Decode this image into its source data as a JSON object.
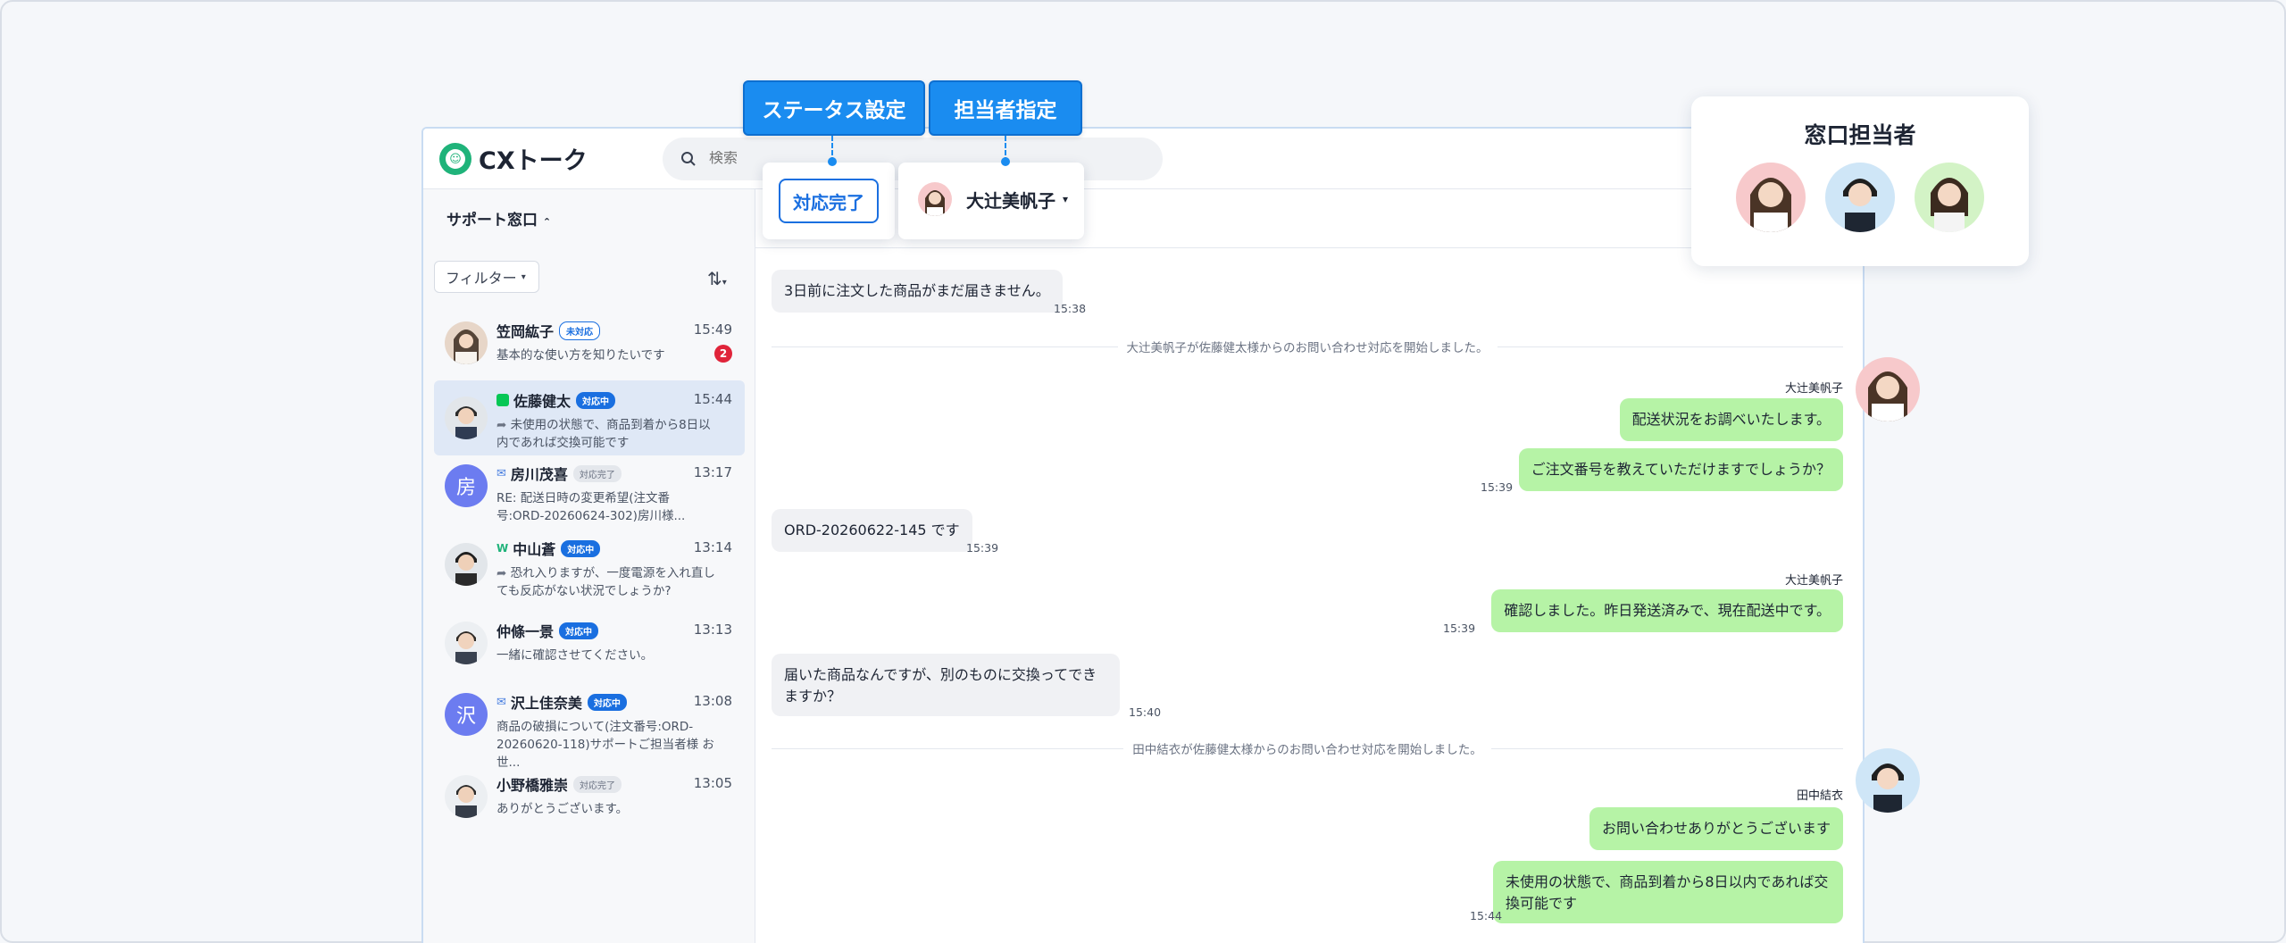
{
  "app": {
    "brand": "CXトーク",
    "search_placeholder": "検索"
  },
  "callouts": {
    "status": "ステータス設定",
    "assignee": "担当者指定"
  },
  "toolbar": {
    "done_label": "対応完了",
    "assignee_name": "大辻美帆子"
  },
  "agents_panel": {
    "title": "窓口担当者"
  },
  "sidebar": {
    "title": "サポート窓口",
    "filter_label": "フィルター",
    "conversations": [
      {
        "name": "笠岡紘子",
        "badge": "未対応",
        "badge_style": "outline",
        "time": "15:49",
        "message": "基本的な使い方を知りたいです",
        "unread": "2",
        "channel": "none"
      },
      {
        "name": "佐藤健太",
        "badge": "対応中",
        "badge_style": "blue",
        "time": "15:44",
        "message": "未使用の状態で、商品到着から8日以内であれば交換可能です",
        "channel": "line",
        "active": true
      },
      {
        "name": "房川茂喜",
        "badge": "対応完了",
        "badge_style": "gray",
        "time": "13:17",
        "message": "RE: 配送日時の変更希望(注文番号:ORD-20260624-302)房川様...",
        "channel": "mail",
        "initial": "房"
      },
      {
        "name": "中山蒼",
        "badge": "対応中",
        "badge_style": "blue",
        "time": "13:14",
        "message": "恐れ入りますが、一度電源を入れ直しても反応がない状況でしょうか?",
        "channel": "web"
      },
      {
        "name": "仲條一景",
        "badge": "対応中",
        "badge_style": "blue",
        "time": "13:13",
        "message": "一緒に確認させてください。",
        "channel": "none"
      },
      {
        "name": "沢上佳奈美",
        "badge": "対応中",
        "badge_style": "blue",
        "time": "13:08",
        "message": "商品の破損について(注文番号:ORD-20260620-118)サポートご担当者様 お世...",
        "channel": "mail",
        "initial": "沢"
      },
      {
        "name": "小野橋雅崇",
        "badge": "対応完了",
        "badge_style": "gray",
        "time": "13:05",
        "message": "ありがとうございます。",
        "channel": "none"
      }
    ]
  },
  "chat": {
    "messages": [
      {
        "kind": "in",
        "text": "3日前に注文した商品がまだ届きません。",
        "time": "15:38"
      },
      {
        "kind": "system",
        "text": "大辻美帆子が佐藤健太様からのお問い合わせ対応を開始しました。"
      },
      {
        "kind": "sender",
        "text": "大辻美帆子"
      },
      {
        "kind": "out",
        "text": "配送状況をお調べいたします。"
      },
      {
        "kind": "out",
        "text": "ご注文番号を教えていただけますでしょうか？",
        "time": "15:39"
      },
      {
        "kind": "in",
        "text": "ORD-20260622-145 です",
        "time": "15:39"
      },
      {
        "kind": "sender",
        "text": "大辻美帆子"
      },
      {
        "kind": "out",
        "text": "確認しました。昨日発送済みで、現在配送中です。",
        "time": "15:39"
      },
      {
        "kind": "in",
        "text": "届いた商品なんですが、別のものに交換ってできますか？",
        "time": "15:40"
      },
      {
        "kind": "system",
        "text": "田中結衣が佐藤健太様からのお問い合わせ対応を開始しました。"
      },
      {
        "kind": "sender",
        "text": "田中結衣"
      },
      {
        "kind": "out",
        "text": "お問い合わせありがとうございます"
      },
      {
        "kind": "out",
        "text": "未使用の状態で、商品到着から8日以内であれば交換可能です",
        "time": "15:44"
      }
    ]
  },
  "colors": {
    "accent": "#1a8cf0",
    "out_bubble": "#b6f3a6",
    "in_bubble": "#f0f1f4",
    "unread": "#e0243a"
  }
}
